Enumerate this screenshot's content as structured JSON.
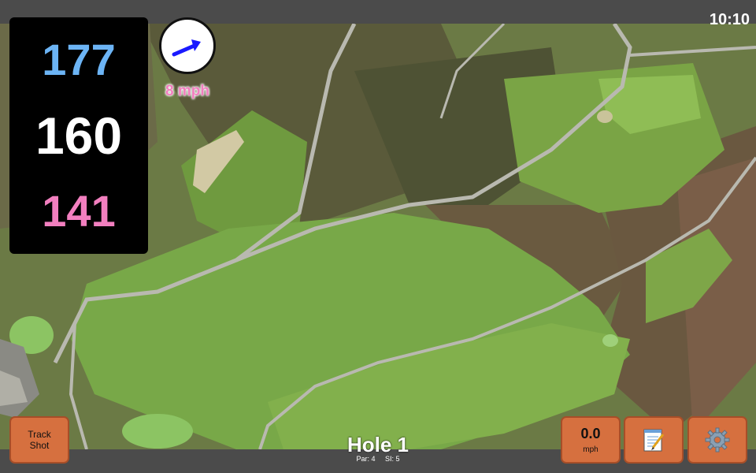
{
  "status": {
    "clock": "10:10"
  },
  "distances": {
    "back": "177",
    "middle": "160",
    "front": "141"
  },
  "wind": {
    "speed_label": "8 mph",
    "direction_icon": "arrow-icon"
  },
  "hole": {
    "title": "Hole 1",
    "par": "Par: 4",
    "stroke_index": "SI: 5"
  },
  "buttons": {
    "track_shot_line1": "Track",
    "track_shot_line2": "Shot",
    "speed_value": "0.0",
    "speed_unit": "mph",
    "notes_icon": "notepad-icon",
    "settings_icon": "gear-icon"
  },
  "colors": {
    "back": "#6cb4f5",
    "middle": "#ffffff",
    "front": "#f27fbf",
    "button": "#d6703f",
    "wind_arrow": "#1a1aff"
  }
}
